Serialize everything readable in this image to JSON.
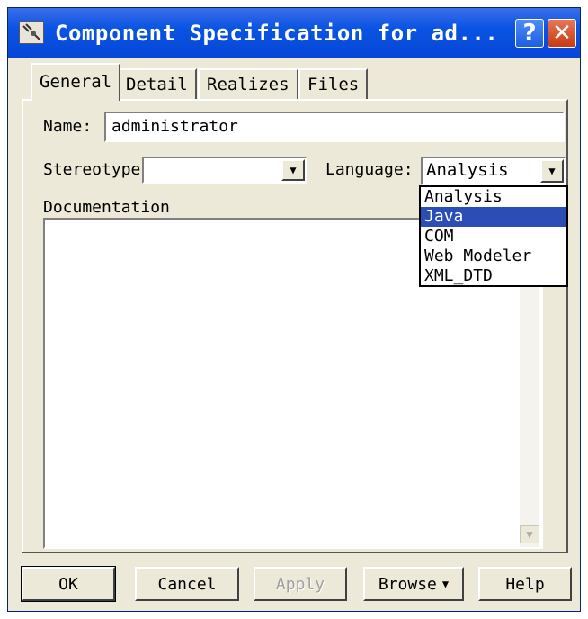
{
  "window": {
    "title": "Component Specification for ad...",
    "help_glyph": "?",
    "close_glyph": "✕"
  },
  "tabs": [
    {
      "label": "General",
      "active": true
    },
    {
      "label": "Detail",
      "active": false
    },
    {
      "label": "Realizes",
      "active": false
    },
    {
      "label": "Files",
      "active": false
    }
  ],
  "form": {
    "name_label": "Name:",
    "name_value": "administrator",
    "stereotype_label": "Stereotype",
    "stereotype_value": "",
    "language_label": "Language:",
    "language_value": "Analysis",
    "documentation_label": "Documentation",
    "documentation_value": ""
  },
  "language_dropdown": {
    "options": [
      "Analysis",
      "Java",
      "COM",
      "Web Modeler",
      "XML_DTD"
    ],
    "highlighted": "Java"
  },
  "buttons": {
    "ok": "OK",
    "cancel": "Cancel",
    "apply": "Apply",
    "browse": "Browse",
    "help": "Help"
  },
  "colors": {
    "titlebar": "#0a54e3",
    "dialog_bg": "#ece9d8",
    "selection": "#2b4db6"
  }
}
